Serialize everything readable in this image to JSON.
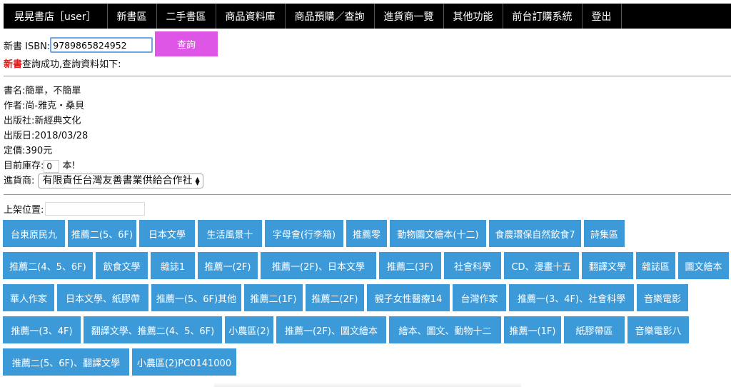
{
  "nav": [
    "晃晃書店［user］",
    "新書區",
    "二手書區",
    "商品資料庫",
    "商品預購／查詢",
    "進貨商一覽",
    "其他功能",
    "前台訂購系統",
    "登出"
  ],
  "isbn": {
    "label": "新書 ISBN:",
    "value": "9789865824952",
    "button": "查詢"
  },
  "result": {
    "highlight": "新書",
    "message": "查詢成功,查詢資料如下:"
  },
  "book": {
    "title": "書名:簡單，不簡單",
    "author": "作者:尚-雅克・桑貝",
    "publisher": "出版社:新經典文化",
    "pubdate": "出版日:2018/03/28",
    "price": "定價:390元",
    "stock_label": "目前庫存:",
    "stock_value": "0",
    "stock_unit": "本!",
    "supplier_label": "進貨商:",
    "supplier_value": "有限責任台灣友善書業供給合作社"
  },
  "shelf": {
    "label": "上架位置:",
    "value": ""
  },
  "tags": [
    [
      "台東原民九",
      "推薦二(5、6F)",
      "日本文學",
      "生活風景十",
      "字母會(行李箱)",
      "推薦零",
      "動物圖文繪本(十二)",
      "食農環保自然飲食7",
      "詩集區"
    ],
    [
      "推薦二(4、5、6F)",
      "飲食文學",
      "雜誌1",
      "推薦一(2F)",
      "推薦一(2F)、日本文學",
      "推薦二(3F)",
      "社會科學",
      "CD、漫畫十五",
      "翻譯文學",
      "雜誌區",
      "圖文繪本"
    ],
    [
      "華人作家",
      "日本文學、紙膠帶",
      "推薦一(5、6F)其他",
      "推薦二(1F)",
      "推薦二(2F)",
      "親子女性醫療14",
      "台灣作家",
      "推薦一(3、4F)、社會科學",
      "音樂電影"
    ],
    [
      "推薦一(3、4F)",
      "翻譯文學、推薦二(4、5、6F)",
      "小農區(2)",
      "推薦一(2F)、圖文繪本",
      "繪本、圖文、動物十二",
      "推薦一(1F)",
      "紙膠帶區",
      "音樂電影八"
    ],
    [
      "推薦二(5、6F)、翻譯文學",
      "小農區(2)PC0141000"
    ]
  ]
}
